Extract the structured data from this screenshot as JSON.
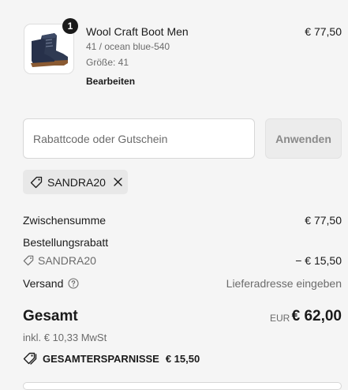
{
  "product": {
    "quantity": "1",
    "name": "Wool Craft Boot Men",
    "variant": "41 / ocean blue-540",
    "size": "Größe: 41",
    "edit_label": "Bearbeiten",
    "price": "€ 77,50"
  },
  "discount": {
    "placeholder": "Rabattcode oder Gutschein",
    "apply_label": "Anwenden",
    "applied_code": "SANDRA20"
  },
  "summary": {
    "subtotal_label": "Zwischensumme",
    "subtotal_value": "€ 77,50",
    "order_discount_label": "Bestellungsrabatt",
    "discount_code": "SANDRA20",
    "discount_value": "− € 15,50",
    "shipping_label": "Versand",
    "shipping_value": "Lieferadresse eingeben",
    "total_label": "Gesamt",
    "currency": "EUR",
    "total_value": "€ 62,00",
    "tax_note": "inkl. € 10,33 MwSt",
    "savings_label": "GESAMTERSPARNISSE",
    "savings_value": "€ 15,50"
  },
  "icons": [
    "boot-image",
    "tag-icon",
    "close-icon",
    "help-circle-icon",
    "tags-icon"
  ]
}
